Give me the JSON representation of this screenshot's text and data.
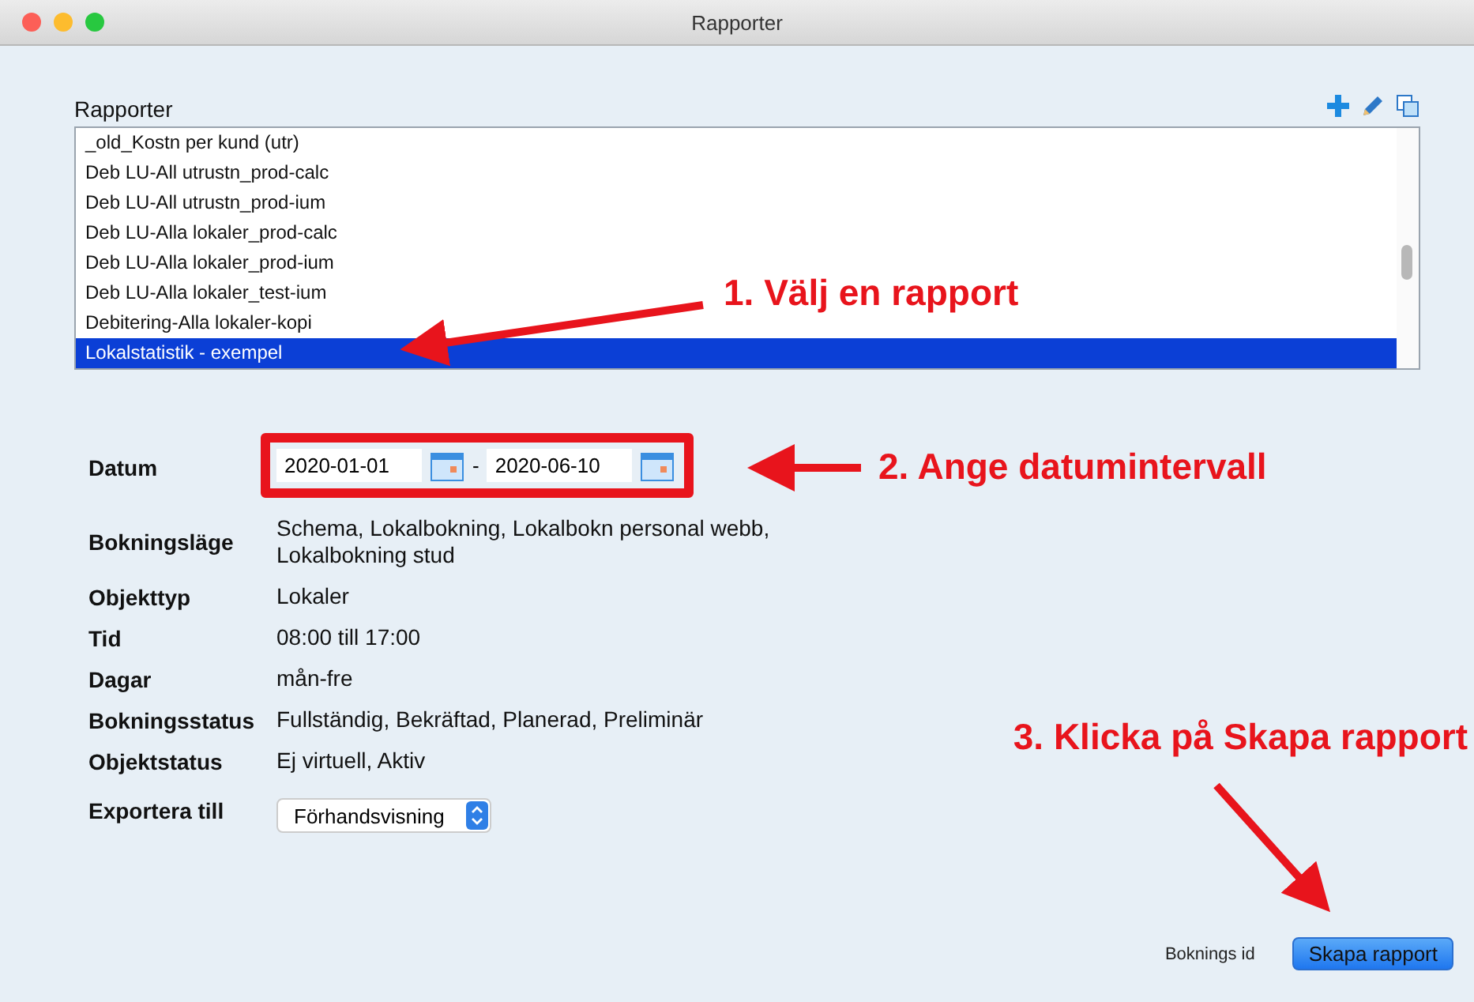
{
  "window": {
    "title": "Rapporter"
  },
  "reports": {
    "label": "Rapporter",
    "items": [
      {
        "name": "_old_Kostn per kund (utr)",
        "selected": false
      },
      {
        "name": "Deb LU-All utrustn_prod-calc",
        "selected": false
      },
      {
        "name": "Deb LU-All utrustn_prod-ium",
        "selected": false
      },
      {
        "name": "Deb LU-Alla lokaler_prod-calc",
        "selected": false
      },
      {
        "name": "Deb LU-Alla lokaler_prod-ium",
        "selected": false
      },
      {
        "name": "Deb LU-Alla lokaler_test-ium",
        "selected": false
      },
      {
        "name": "Debitering-Alla lokaler-kopi",
        "selected": false
      },
      {
        "name": "Lokalstatistik - exempel",
        "selected": true
      }
    ]
  },
  "form": {
    "date": {
      "label": "Datum",
      "from": "2020-01-01",
      "separator": "-",
      "to": "2020-06-10"
    },
    "fields": [
      {
        "label": "Bokningsläge",
        "value": "Schema, Lokalbokning, Lokalbokn personal webb, Lokalbokning stud"
      },
      {
        "label": "Objekttyp",
        "value": "Lokaler"
      },
      {
        "label": "Tid",
        "value": "08:00 till 17:00"
      },
      {
        "label": "Dagar",
        "value": "mån-fre"
      },
      {
        "label": "Bokningsstatus",
        "value": "Fullständig, Bekräftad, Planerad, Preliminär"
      },
      {
        "label": "Objektstatus",
        "value": "Ej virtuell, Aktiv"
      }
    ],
    "export": {
      "label": "Exportera till",
      "value": "Förhandsvisning"
    }
  },
  "footer": {
    "booking_id_label": "Boknings id",
    "create_button": "Skapa rapport"
  },
  "annotations": [
    "1. Välj en rapport",
    "2. Ange datumintervall",
    "3. Klicka på Skapa rapport"
  ]
}
